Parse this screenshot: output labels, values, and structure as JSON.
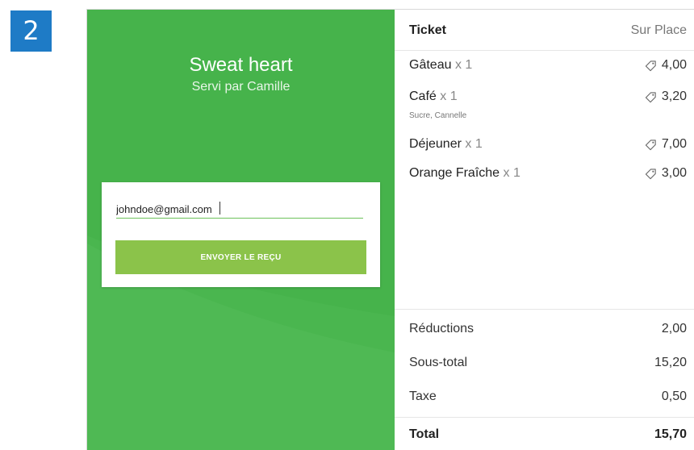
{
  "step": {
    "number": "2",
    "color": "#1e7bc6"
  },
  "left_panel": {
    "shop_name": "Sweat heart",
    "served_by": "Servi par Camille",
    "background_color": "#46b34b",
    "email_value": "johndoe@gmail.com",
    "send_label": "ENVOYER LE REÇU",
    "button_color": "#8bc34a"
  },
  "ticket": {
    "title": "Ticket",
    "order_type": "Sur Place",
    "items": [
      {
        "name": "Gâteau",
        "qty": "x 1",
        "modifiers": "",
        "price": "4,00",
        "icon": "tag-icon"
      },
      {
        "name": "Café",
        "qty": "x 1",
        "modifiers": "Sucre, Cannelle",
        "price": "3,20",
        "icon": "tag-icon"
      },
      {
        "name": "Déjeuner",
        "qty": "x 1",
        "modifiers": "",
        "price": "7,00",
        "icon": "tag-icon"
      },
      {
        "name": "Orange Fraîche",
        "qty": "x 1",
        "modifiers": "",
        "price": "3,00",
        "icon": "tag-icon"
      }
    ],
    "summary": {
      "discounts_label": "Réductions",
      "discounts_value": "2,00",
      "subtotal_label": "Sous-total",
      "subtotal_value": "15,20",
      "tax_label": "Taxe",
      "tax_value": "0,50",
      "total_label": "Total",
      "total_value": "15,70"
    }
  }
}
